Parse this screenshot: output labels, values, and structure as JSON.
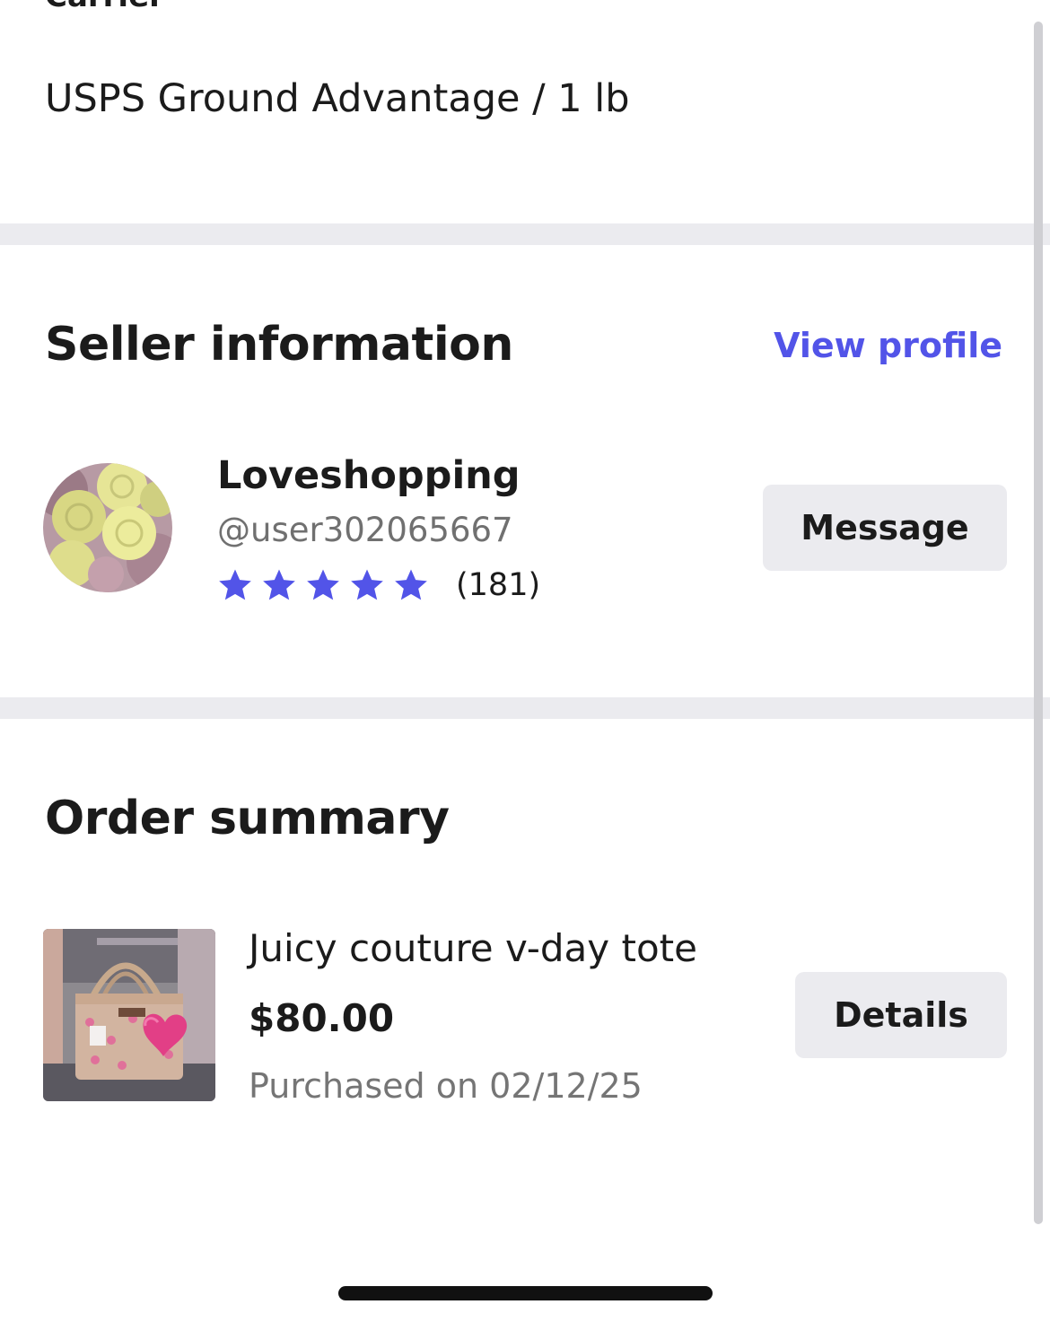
{
  "shipping": {
    "carrier_label": "Carrier",
    "carrier_value": "USPS Ground Advantage / 1 lb"
  },
  "seller": {
    "section_title": "Seller information",
    "view_profile_label": "View profile",
    "name": "Loveshopping",
    "handle": "@user302065667",
    "rating_stars": 5,
    "rating_count": "(181)",
    "message_label": "Message",
    "avatar_icon": "roses-avatar"
  },
  "order": {
    "section_title": "Order summary",
    "item_title": "Juicy couture v-day tote",
    "item_price": "$80.00",
    "purchased_text": "Purchased on 02/12/25",
    "details_label": "Details",
    "item_image_icon": "tote-bag-photo"
  },
  "colors": {
    "accent": "#5254e8",
    "divider": "#ebebef",
    "button_bg": "#ebebef",
    "text_primary": "#1b1b1b",
    "text_secondary": "#707070"
  }
}
